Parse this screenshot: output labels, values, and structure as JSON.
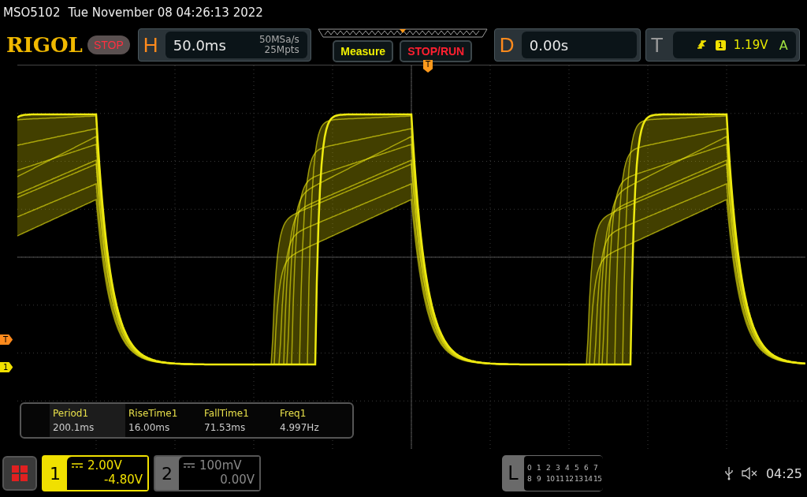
{
  "status_line": {
    "model": "MSO5102",
    "datetime": "Tue November 08 04:26:13 2022"
  },
  "logo": "RIGOL",
  "run_state": "STOP",
  "horizontal": {
    "label": "H",
    "timebase": "50.0ms",
    "sample_rate": "50MSa/s",
    "memory_depth": "25Mpts"
  },
  "buttons": [
    {
      "label": "Measure",
      "kind": "measure"
    },
    {
      "label": "STOP/RUN",
      "kind": "run"
    }
  ],
  "delay": {
    "label": "D",
    "value": "0.00s"
  },
  "trigger": {
    "label": "T",
    "source": "1",
    "voltage": "1.19V",
    "mode": "A"
  },
  "markers": {
    "trigger_position": "T",
    "trigger_voltage": "T",
    "channel_1": "1"
  },
  "measurements": [
    {
      "name": "Period1",
      "value": "200.1ms",
      "selected": true
    },
    {
      "name": "RiseTime1",
      "value": "16.00ms",
      "selected": false
    },
    {
      "name": "FallTime1",
      "value": "71.53ms",
      "selected": false
    },
    {
      "name": "Freq1",
      "value": "4.997Hz",
      "selected": false
    }
  ],
  "channels": [
    {
      "number": "1",
      "scale": "2.00V",
      "offset": "-4.80V",
      "selected": true
    },
    {
      "number": "2",
      "scale": "100mV",
      "offset": "0.00V",
      "selected": false
    }
  ],
  "logic": {
    "label": "L",
    "rows": [
      [
        "0",
        "1",
        "2",
        "3",
        "4",
        "5",
        "6",
        "7"
      ],
      [
        "8",
        "9",
        "10",
        "11",
        "12",
        "13",
        "14",
        "15"
      ]
    ]
  },
  "clock": "04:25"
}
